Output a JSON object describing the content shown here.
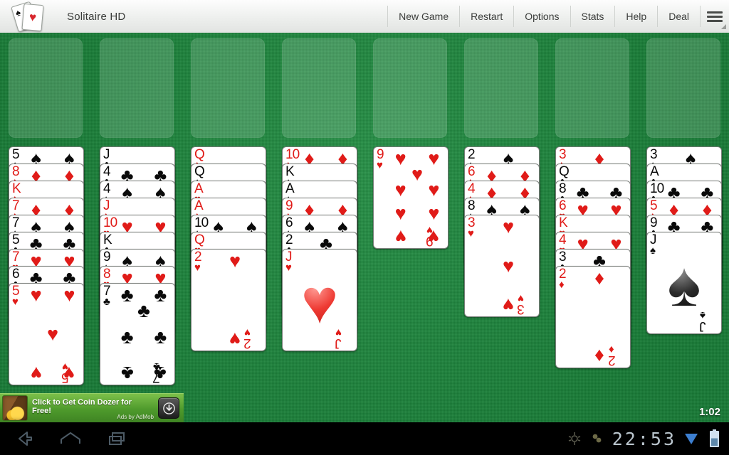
{
  "header": {
    "app_title": "Solitaire HD",
    "icon_name": "solitaire-cards-icon",
    "menu_items": [
      "New Game",
      "Restart",
      "Options",
      "Stats",
      "Help",
      "Deal"
    ],
    "overflow_icon": "hamburger-menu-icon"
  },
  "colors": {
    "felt_green": "#1a8a3c",
    "empty_slot": "rgba(255,255,255,0.16)",
    "card_red": "#e01b18",
    "card_black": "#0a0a0a",
    "header_bg": "#eceeec",
    "ad_green": "#4e9a2c",
    "navbar_black": "#000000",
    "clock_blue": "#b9c4cc"
  },
  "foundations": {
    "count": 8,
    "state": "empty",
    "label": "empty-foundation-slot"
  },
  "tableau": {
    "columns": [
      {
        "col": 1,
        "cards": [
          {
            "rank": "5",
            "suit": "spades"
          },
          {
            "rank": "8",
            "suit": "diamonds"
          },
          {
            "rank": "K",
            "suit": "diamonds"
          },
          {
            "rank": "7",
            "suit": "diamonds"
          },
          {
            "rank": "7",
            "suit": "spades"
          },
          {
            "rank": "5",
            "suit": "clubs"
          },
          {
            "rank": "7",
            "suit": "hearts"
          },
          {
            "rank": "6",
            "suit": "clubs"
          },
          {
            "rank": "5",
            "suit": "hearts"
          }
        ]
      },
      {
        "col": 2,
        "cards": [
          {
            "rank": "J",
            "suit": "clubs"
          },
          {
            "rank": "4",
            "suit": "clubs"
          },
          {
            "rank": "4",
            "suit": "spades"
          },
          {
            "rank": "J",
            "suit": "diamonds"
          },
          {
            "rank": "10",
            "suit": "hearts"
          },
          {
            "rank": "K",
            "suit": "clubs"
          },
          {
            "rank": "9",
            "suit": "spades"
          },
          {
            "rank": "8",
            "suit": "hearts"
          },
          {
            "rank": "7",
            "suit": "clubs"
          }
        ]
      },
      {
        "col": 3,
        "cards": [
          {
            "rank": "Q",
            "suit": "diamonds"
          },
          {
            "rank": "Q",
            "suit": "spades"
          },
          {
            "rank": "A",
            "suit": "hearts"
          },
          {
            "rank": "A",
            "suit": "diamonds"
          },
          {
            "rank": "10",
            "suit": "spades"
          },
          {
            "rank": "Q",
            "suit": "hearts"
          },
          {
            "rank": "2",
            "suit": "hearts"
          }
        ]
      },
      {
        "col": 4,
        "cards": [
          {
            "rank": "10",
            "suit": "diamonds"
          },
          {
            "rank": "K",
            "suit": "spades"
          },
          {
            "rank": "A",
            "suit": "spades"
          },
          {
            "rank": "9",
            "suit": "diamonds"
          },
          {
            "rank": "6",
            "suit": "spades"
          },
          {
            "rank": "2",
            "suit": "clubs"
          },
          {
            "rank": "J",
            "suit": "hearts"
          }
        ]
      },
      {
        "col": 5,
        "cards": [
          {
            "rank": "9",
            "suit": "hearts"
          }
        ]
      },
      {
        "col": 6,
        "cards": [
          {
            "rank": "2",
            "suit": "spades"
          },
          {
            "rank": "6",
            "suit": "diamonds"
          },
          {
            "rank": "4",
            "suit": "diamonds"
          },
          {
            "rank": "8",
            "suit": "spades"
          },
          {
            "rank": "3",
            "suit": "hearts"
          }
        ]
      },
      {
        "col": 7,
        "cards": [
          {
            "rank": "3",
            "suit": "diamonds"
          },
          {
            "rank": "Q",
            "suit": "clubs"
          },
          {
            "rank": "8",
            "suit": "clubs"
          },
          {
            "rank": "6",
            "suit": "hearts"
          },
          {
            "rank": "K",
            "suit": "hearts"
          },
          {
            "rank": "4",
            "suit": "hearts"
          },
          {
            "rank": "3",
            "suit": "clubs"
          },
          {
            "rank": "2",
            "suit": "diamonds"
          }
        ]
      },
      {
        "col": 8,
        "cards": [
          {
            "rank": "3",
            "suit": "spades"
          },
          {
            "rank": "A",
            "suit": "clubs"
          },
          {
            "rank": "10",
            "suit": "clubs"
          },
          {
            "rank": "5",
            "suit": "diamonds"
          },
          {
            "rank": "9",
            "suit": "clubs"
          },
          {
            "rank": "J",
            "suit": "spades"
          }
        ]
      }
    ]
  },
  "game_timer": "1:02",
  "ad": {
    "line1": "Click to Get Coin Dozer for",
    "line2": "Free!",
    "attribution": "Ads by AdMob",
    "thumb_name": "coin-dozer-thumbnail",
    "download_icon": "download-arrow-icon"
  },
  "navbar": {
    "back_icon": "back-arrow-icon",
    "home_icon": "home-icon",
    "recents_icon": "recent-apps-icon",
    "usb_icon": "usb-debug-icon",
    "sync_icon": "sync-icon",
    "clock": "22:53",
    "wifi_icon": "wifi-icon",
    "battery_icon": "battery-icon"
  }
}
